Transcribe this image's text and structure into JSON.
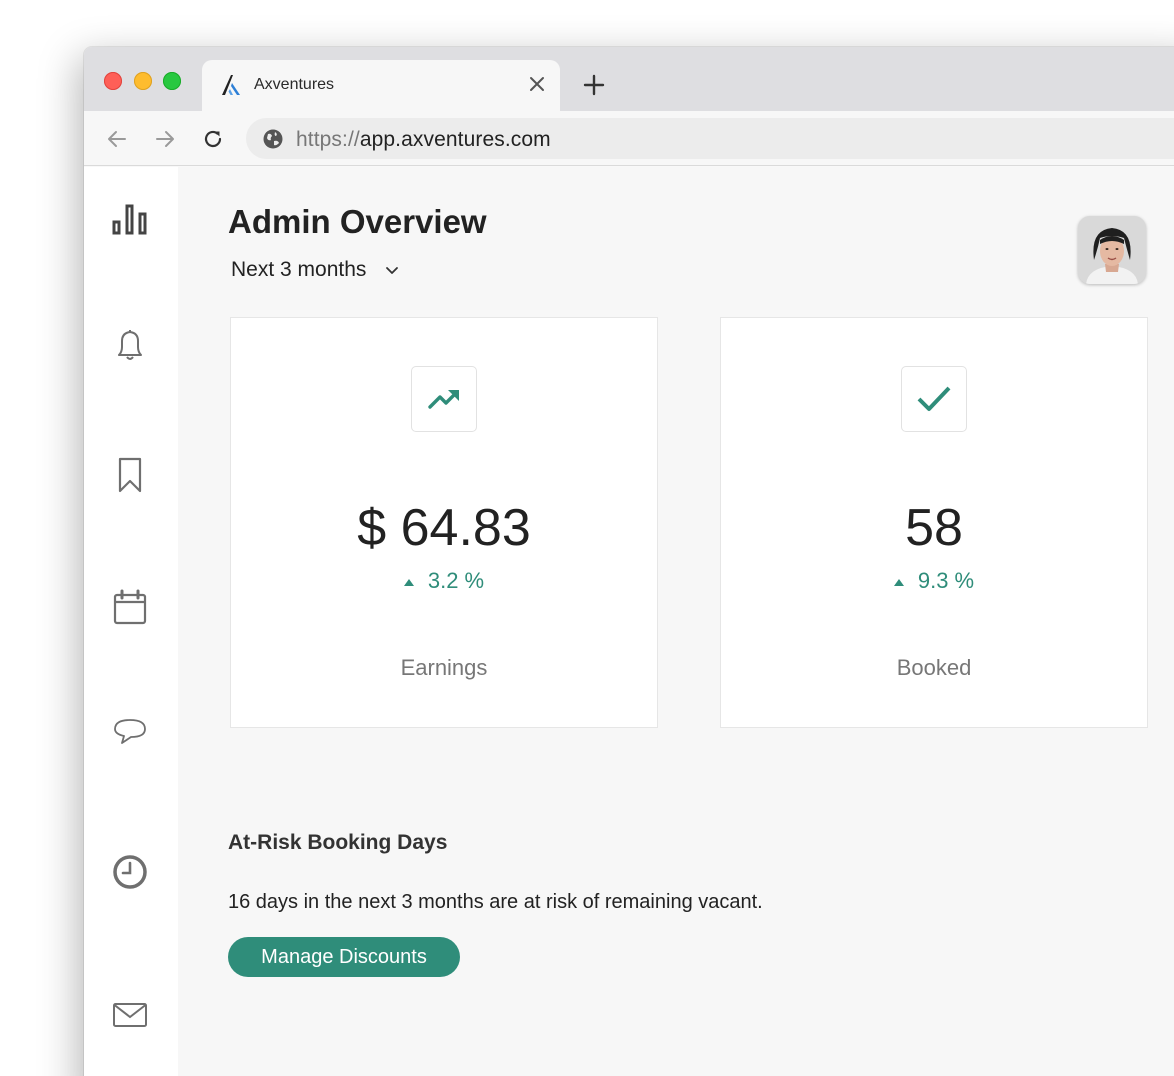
{
  "browser": {
    "tab_title": "Axventures",
    "url_scheme": "https://",
    "url_host": "app.axventures.com"
  },
  "sidebar": {
    "items": [
      {
        "icon": "bar-chart-icon"
      },
      {
        "icon": "bell-icon"
      },
      {
        "icon": "bookmark-icon"
      },
      {
        "icon": "calendar-icon"
      },
      {
        "icon": "chat-bubble-icon"
      },
      {
        "icon": "clock-icon"
      },
      {
        "icon": "mail-icon"
      }
    ]
  },
  "header": {
    "title": "Admin Overview",
    "period": "Next 3 months"
  },
  "cards": [
    {
      "icon": "trending-up-icon",
      "value": "$ 64.83",
      "delta": "3.2 %",
      "label": "Earnings"
    },
    {
      "icon": "checkmark-icon",
      "value": "58",
      "delta": "9.3 %",
      "label": "Booked"
    }
  ],
  "risk": {
    "heading": "At-Risk Booking Days",
    "text": "16 days in the next 3 months are at risk of remaining vacant.",
    "button": "Manage Discounts"
  },
  "colors": {
    "accent": "#2f8d7a",
    "sidebar_icon": "#6f6f6f"
  }
}
